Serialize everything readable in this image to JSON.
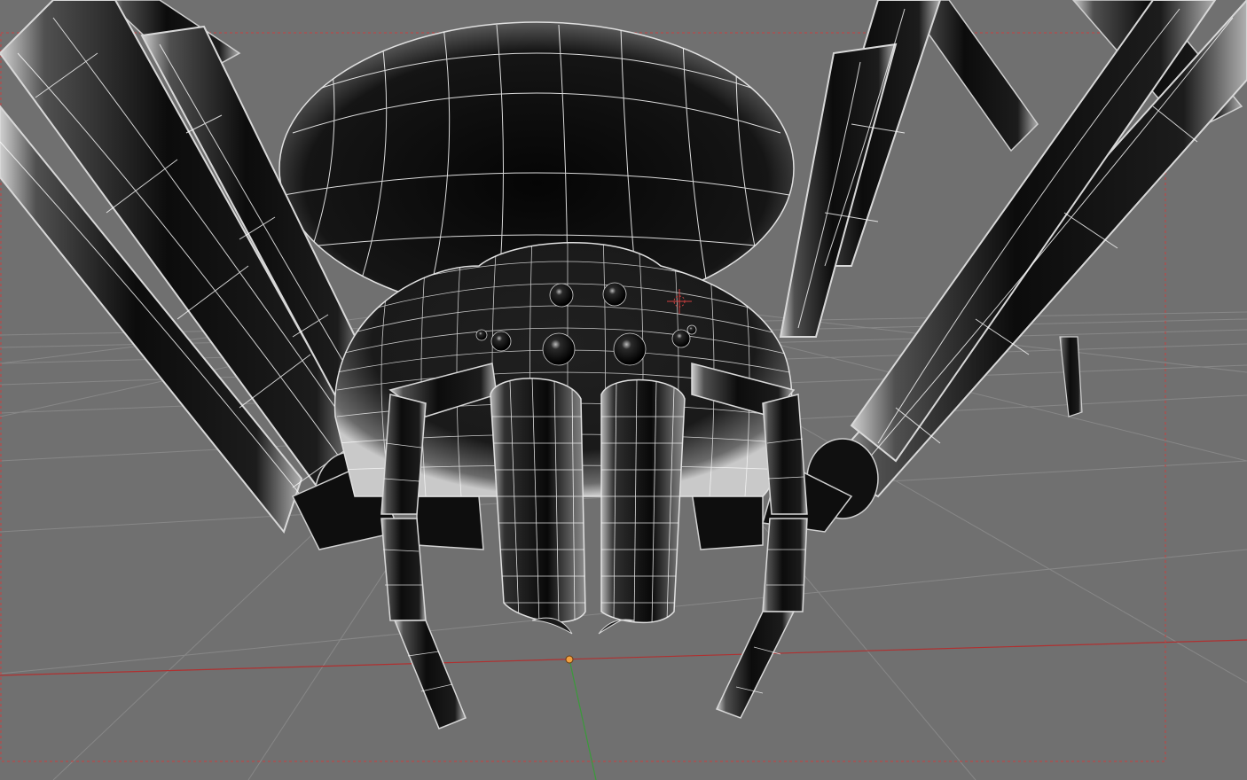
{
  "viewport": {
    "background_color": "#707070",
    "grid_color": "#8a8a8a",
    "grid_highlight_color": "#a8a8a8",
    "x_axis_color": "#b03030",
    "y_axis_color": "#3a9a3a",
    "safe_frame_color": "#c84040",
    "pivot_color": "#f0a040"
  },
  "model": {
    "name": "spider",
    "shell_color": "#0a0a0a",
    "rim_color": "#d8d8d8",
    "wire_color": "#ffffff",
    "eye_count": 8
  }
}
